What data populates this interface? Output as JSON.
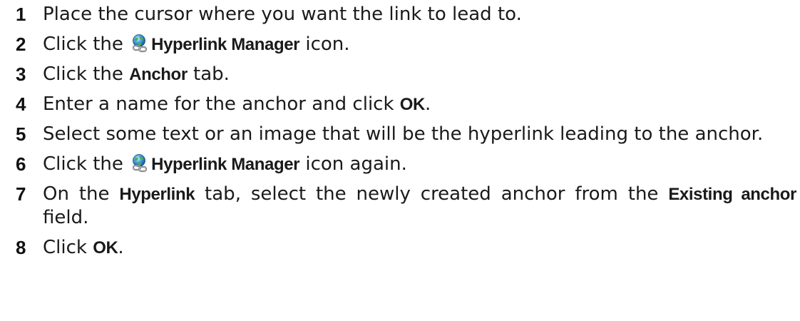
{
  "steps": [
    {
      "num": "1",
      "parts": [
        {
          "t": "Place the cursor where you want the link to lead to."
        }
      ]
    },
    {
      "num": "2",
      "parts": [
        {
          "t": "Click the "
        },
        {
          "icon": "hyperlink-manager-icon"
        },
        {
          "t": "Hyperlink Manager",
          "bold": true
        },
        {
          "t": " icon."
        }
      ]
    },
    {
      "num": "3",
      "parts": [
        {
          "t": "Click the "
        },
        {
          "t": "Anchor",
          "bold": true
        },
        {
          "t": " tab."
        }
      ]
    },
    {
      "num": "4",
      "parts": [
        {
          "t": "Enter a name for the anchor and click "
        },
        {
          "t": "OK",
          "bold": true
        },
        {
          "t": "."
        }
      ]
    },
    {
      "num": "5",
      "parts": [
        {
          "t": "Select some text or an image that will be the hyperlink leading to the anchor."
        }
      ]
    },
    {
      "num": "6",
      "parts": [
        {
          "t": "Click  the "
        },
        {
          "icon": "hyperlink-manager-icon"
        },
        {
          "t": "Hyperlink Manager",
          "bold": true
        },
        {
          "t": " icon again."
        }
      ]
    },
    {
      "num": "7",
      "parts": [
        {
          "t": "On the "
        },
        {
          "t": "Hyperlink",
          "bold": true
        },
        {
          "t": " tab, select the newly created anchor from the "
        },
        {
          "t": "Existing anchor",
          "bold": true
        },
        {
          "t": " field."
        }
      ]
    },
    {
      "num": "8",
      "parts": [
        {
          "t": "Click "
        },
        {
          "t": "OK",
          "bold": true
        },
        {
          "t": "."
        }
      ]
    }
  ]
}
